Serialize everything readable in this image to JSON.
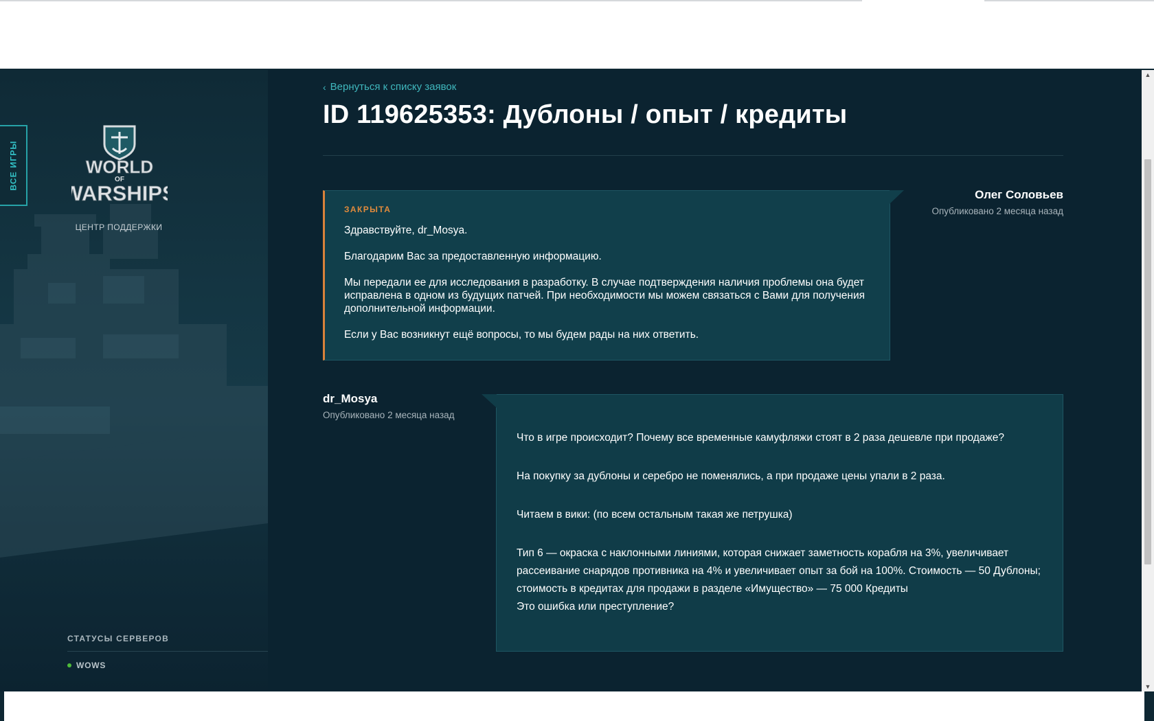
{
  "sidebar": {
    "all_games_tab": "ВСЕ ИГРЫ",
    "logo_text": "WORLD OF WARSHIPS",
    "support_label": "ЦЕНТР ПОДДЕРЖКИ",
    "server_status_heading": "СТАТУСЫ СЕРВЕРОВ",
    "servers": [
      {
        "name": "WOWS",
        "status_color": "#4dbb3a"
      }
    ]
  },
  "ticket": {
    "back_link": "Вернуться к списку заявок",
    "title": "ID 119625353: Дублоны / опыт / кредиты"
  },
  "messages": {
    "support": {
      "author": "Олег Соловьев",
      "published": "Опубликовано 2 месяца назад",
      "status": "ЗАКРЫТА",
      "paragraphs": [
        "Здравствуйте, dr_Mosya.",
        "Благодарим Вас за предоставленную информацию.",
        "Мы передали ее для исследования в разработку. В случае подтверждения наличия проблемы она будет исправлена в одном из будущих патчей. При необходимости мы можем связаться с Вами для получения дополнительной информации.",
        "Если у Вас возникнут ещё вопросы, то мы будем рады на них ответить."
      ]
    },
    "user": {
      "author": "dr_Mosya",
      "published": "Опубликовано 2 месяца назад",
      "paragraphs": [
        "Что в игре происходит? Почему все временные камуфляжи стоят в 2 раза дешевле при продаже?",
        "На покупку за дублоны и серебро не поменялись, а при продаже цены упали в 2 раза.",
        "Читаем в вики: (по всем остальным такая же петрушка)",
        "Тип 6 — окраска с наклонными линиями, которая снижает заметность корабля на 3%, увеличивает рассеивание снарядов противника на 4% и увеличивает опыт за бой на 100%. Стоимость — 50 Дублоны; стоимость в кредитах для продажи в разделе «Имущество» — 75 000 Кредиты",
        "Это ошибка или преступление?"
      ]
    }
  },
  "colors": {
    "accent_teal": "#3fb7bd",
    "status_closed": "#e08a3c",
    "background": "#0b2330",
    "bubble": "#113f4b"
  }
}
